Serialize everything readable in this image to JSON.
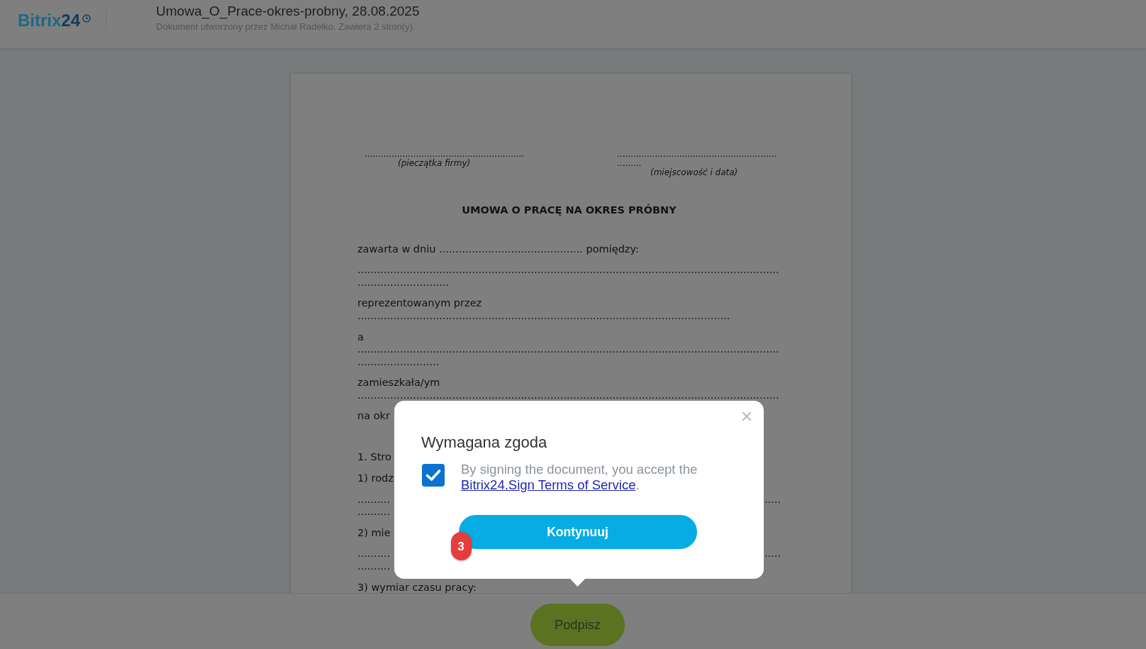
{
  "header": {
    "logo": {
      "brand": "Bitrix",
      "number": "24"
    },
    "title": "Umowa_O_Prace-okres-probny, 28.08.2025",
    "subtitle": "Dokument utworzony przez Michał Radełko. Zawiera 2 stron(y)."
  },
  "document": {
    "signature_blocks": [
      {
        "lines": [
          "..........................................................."
        ],
        "caption": "(pieczątka firmy)"
      },
      {
        "lines": [
          "...........................................................",
          "........."
        ],
        "caption": "(miejscowość i data)"
      }
    ],
    "heading": "UMOWA O PRACĘ NA OKRES PRÓBNY",
    "paragraphs": [
      {
        "kind": "text",
        "lines": [
          {
            "text": "zawarta w dniu ............................................ pomiędzy:"
          }
        ]
      },
      {
        "kind": "text",
        "lines": [
          {
            "text": "................................................................................................................................."
          },
          {
            "text": "............................"
          }
        ]
      },
      {
        "kind": "text",
        "lines": [
          {
            "text": "reprezentowanym przez"
          },
          {
            "text": ".................................................................................................................."
          }
        ]
      },
      {
        "kind": "text",
        "lines": [
          {
            "text": "a"
          },
          {
            "text": "................................................................................................................................."
          },
          {
            "text": "........................."
          }
        ]
      },
      {
        "kind": "text",
        "lines": [
          {
            "text": "zamieszkała/ym"
          },
          {
            "text": "................................................................................................................................."
          }
        ]
      },
      {
        "kind": "text",
        "lines": [
          {
            "text": "na okr"
          }
        ]
      },
      {
        "kind": "clause",
        "lines": [
          {
            "text": "1. Stro"
          }
        ]
      },
      {
        "kind": "text",
        "lines": [
          {
            "text": "1) rodz"
          }
        ]
      },
      {
        "kind": "text",
        "lines": [
          {
            "text": "..........",
            "right": "....."
          },
          {
            "text": ".........."
          }
        ]
      },
      {
        "kind": "text",
        "lines": [
          {
            "text": "2) mie"
          }
        ]
      },
      {
        "kind": "text",
        "lines": [
          {
            "text": "..........",
            "right": "....."
          },
          {
            "text": ".........."
          }
        ]
      },
      {
        "kind": "text",
        "lines": [
          {
            "text": "3) wymiar czasu pracy:"
          }
        ]
      }
    ]
  },
  "dialog": {
    "title": "Wymagana zgoda",
    "consent": {
      "checked": true,
      "text": "By signing the document, you accept the",
      "link": "Bitrix24.Sign Terms of Service",
      "end": "."
    },
    "button": {
      "label": "Kontynuuj",
      "step": "3"
    }
  },
  "footer": {
    "sign_button": "Podpisz"
  }
}
